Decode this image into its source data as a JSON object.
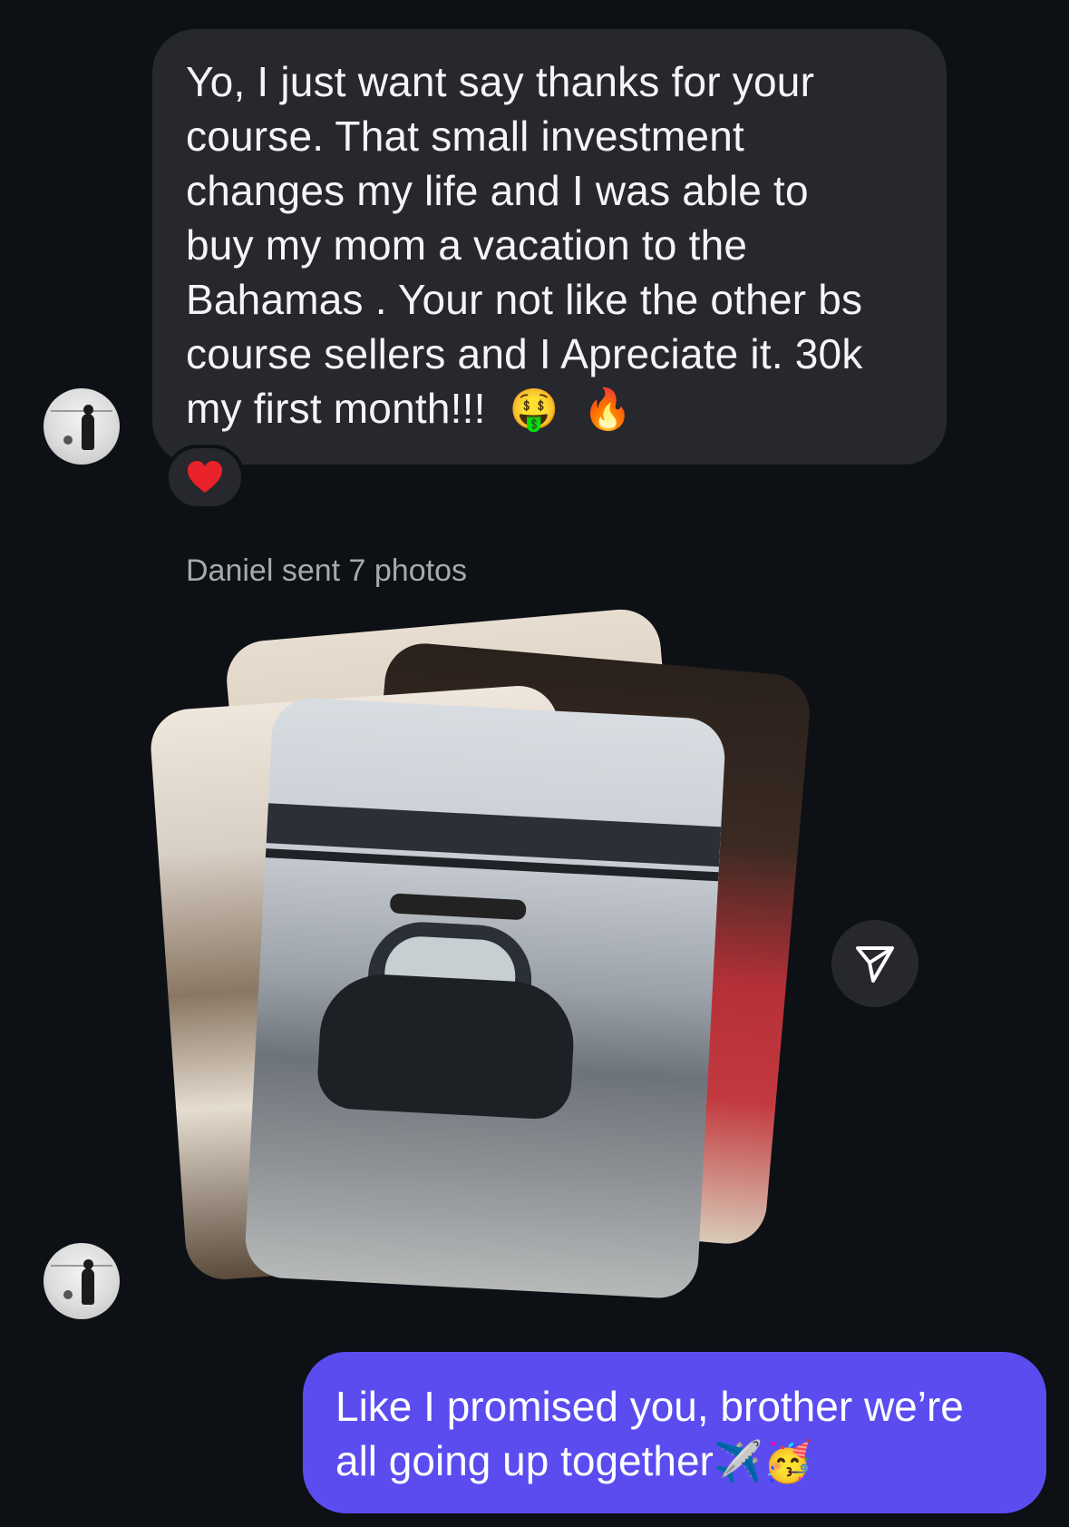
{
  "incoming_message": {
    "lines": [
      "Yo, I just want say thanks for your",
      "course. That small investment",
      "changes my life and I was able to",
      "buy my mom a vacation to the",
      "Bahamas . Your not like the other bs",
      "course sellers and I Apreciate it. 30k",
      "my first month!!!"
    ],
    "emoji_1": "🤑",
    "emoji_2": "🔥",
    "reaction": "❤️"
  },
  "photos_caption": "Daniel sent 7 photos",
  "outgoing_message": {
    "lines": [
      "Like I promised you, brother we’re",
      "all going up together"
    ],
    "emoji_1": "✈️",
    "emoji_2": "🥳"
  },
  "colors": {
    "background": "#0d1015",
    "incoming_bubble": "#26282d",
    "outgoing_bubble": "#5b4cf0",
    "caption": "#a6a9ae",
    "reaction_heart": "#e8212b"
  },
  "icons": {
    "share": "paper-plane-icon",
    "reaction": "heart-icon"
  }
}
